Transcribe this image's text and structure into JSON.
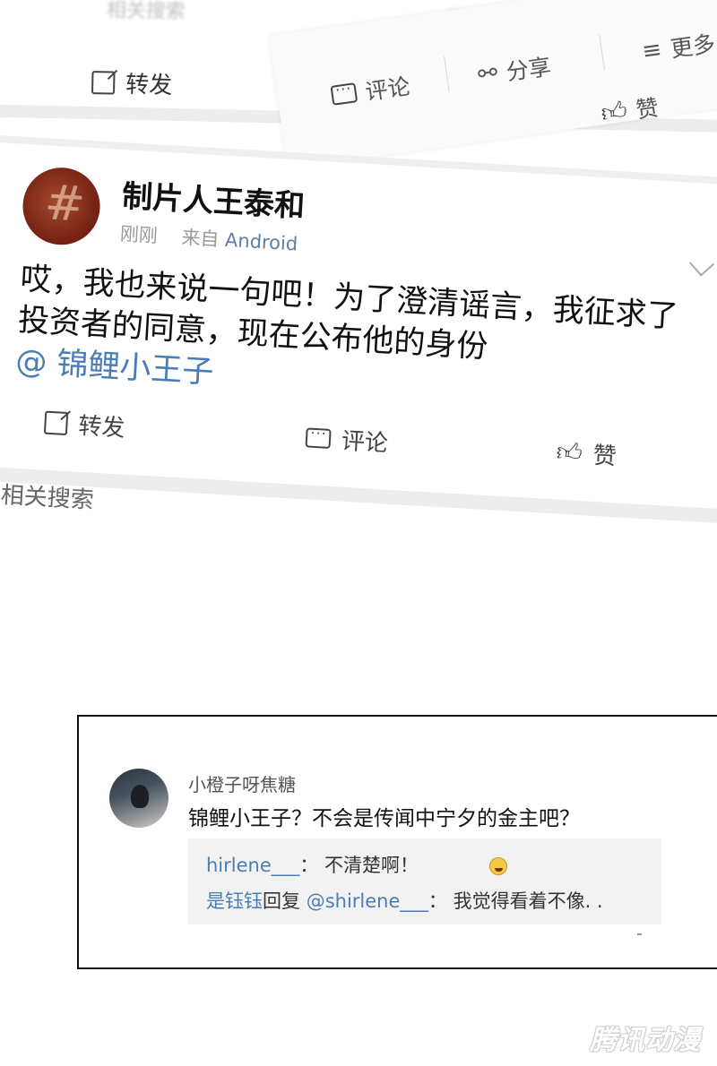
{
  "bg_post_top": {
    "search_hint": "相关搜索",
    "repost": "转发"
  },
  "bg_post_tilted": {
    "comment": "评论",
    "share": "分享",
    "more": "更多",
    "like": "赞"
  },
  "post": {
    "username": "制片人王泰和",
    "time": "刚刚",
    "source_prefix": "来自",
    "source": "Android",
    "content": "哎，我也来说一句吧！为了澄清谣言，我征求了投资者的同意，现在公布他的身份",
    "mention": "@ 锦鲤小王子",
    "actions": {
      "repost": "转发",
      "comment": "评论",
      "like": "赞"
    }
  },
  "related_search": "相关搜索",
  "comment_panel": {
    "commenter": "小橙子呀焦糖",
    "comment": "锦鲤小王子？不会是传闻中宁夕的金主吧？",
    "replies": [
      {
        "user": "hirlene___",
        "sep": "：",
        "text": "不清楚啊！"
      },
      {
        "user": "是钰钰",
        "verb": "回复",
        "target": "@shirlene___",
        "sep": "：",
        "text": "我觉得看着不像. ."
      }
    ]
  },
  "watermark": "腾讯动漫"
}
